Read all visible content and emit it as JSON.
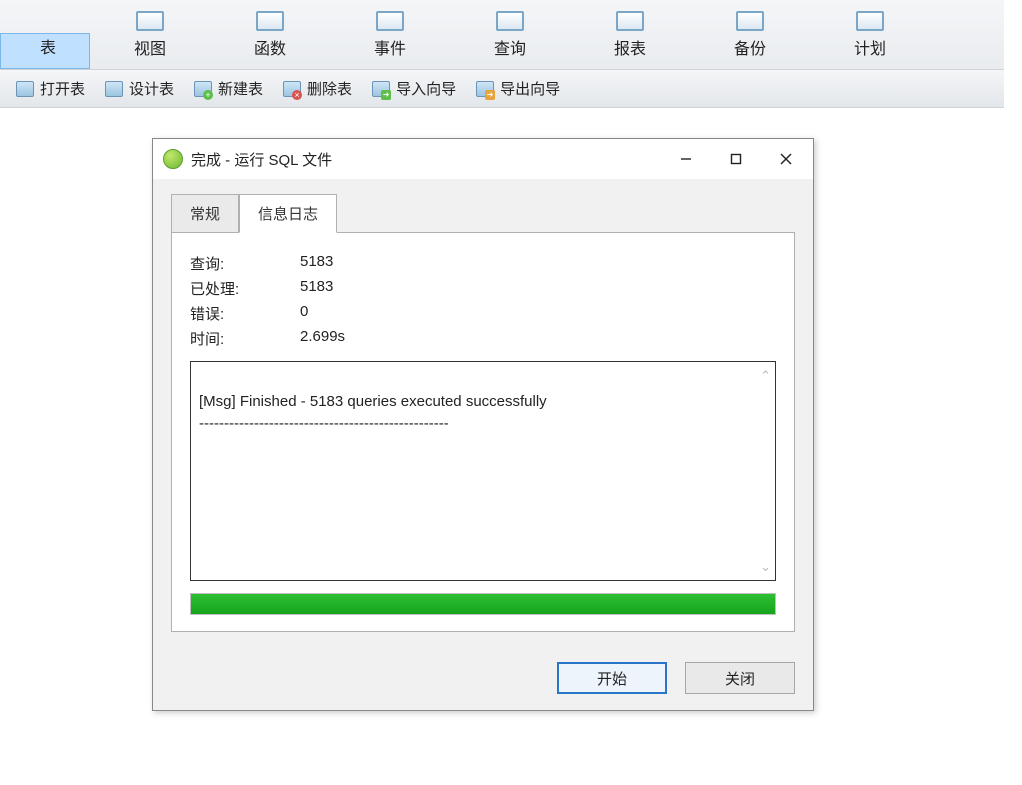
{
  "topToolbar": [
    {
      "label": "表",
      "active": true,
      "name": "nav-table"
    },
    {
      "label": "视图",
      "active": false,
      "name": "nav-view"
    },
    {
      "label": "函数",
      "active": false,
      "name": "nav-function"
    },
    {
      "label": "事件",
      "active": false,
      "name": "nav-event"
    },
    {
      "label": "查询",
      "active": false,
      "name": "nav-query"
    },
    {
      "label": "报表",
      "active": false,
      "name": "nav-report"
    },
    {
      "label": "备份",
      "active": false,
      "name": "nav-backup"
    },
    {
      "label": "计划",
      "active": false,
      "name": "nav-schedule"
    }
  ],
  "subToolbar": [
    {
      "label": "打开表",
      "icon": "open",
      "name": "open-table"
    },
    {
      "label": "设计表",
      "icon": "open",
      "name": "design-table"
    },
    {
      "label": "新建表",
      "icon": "plus",
      "name": "new-table"
    },
    {
      "label": "删除表",
      "icon": "minus",
      "name": "delete-table"
    },
    {
      "label": "导入向导",
      "icon": "arrow-in",
      "name": "import-wizard"
    },
    {
      "label": "导出向导",
      "icon": "arrow-out",
      "name": "export-wizard"
    }
  ],
  "dialog": {
    "title": "完成 - 运行 SQL 文件",
    "tabs": [
      {
        "label": "常规",
        "active": false
      },
      {
        "label": "信息日志",
        "active": true
      }
    ],
    "stats": {
      "query_label": "查询:",
      "query_value": "5183",
      "processed_label": "已处理:",
      "processed_value": "5183",
      "error_label": "错误:",
      "error_value": "0",
      "time_label": "时间:",
      "time_value": "2.699s"
    },
    "log": "[Msg] Finished - 5183 queries executed successfully\n--------------------------------------------------",
    "progress_percent": 100,
    "buttons": {
      "start": "开始",
      "close": "关闭"
    }
  }
}
